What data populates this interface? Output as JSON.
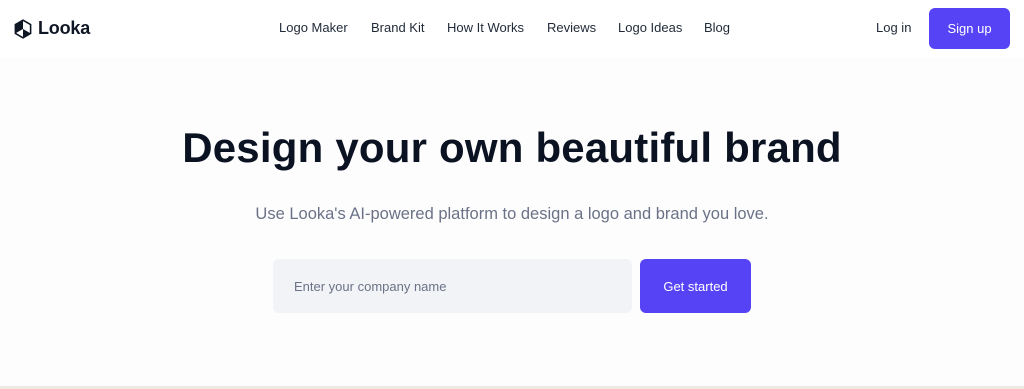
{
  "brand": {
    "name": "Looka",
    "logo_icon": "looka-hexagon-icon"
  },
  "nav": {
    "items": [
      {
        "label": "Logo Maker"
      },
      {
        "label": "Brand Kit"
      },
      {
        "label": "How It Works"
      },
      {
        "label": "Reviews"
      },
      {
        "label": "Logo Ideas"
      },
      {
        "label": "Blog"
      }
    ],
    "login_label": "Log in",
    "signup_label": "Sign up"
  },
  "hero": {
    "headline": "Design your own beautiful brand",
    "subheadline": "Use Looka's AI-powered platform to design a logo and brand you love.",
    "input_placeholder": "Enter your company name",
    "input_value": "",
    "cta_label": "Get started"
  },
  "colors": {
    "accent": "#5643f5",
    "heading": "#0b1221",
    "muted_text": "#6b7287",
    "input_bg": "#f2f3f6"
  }
}
